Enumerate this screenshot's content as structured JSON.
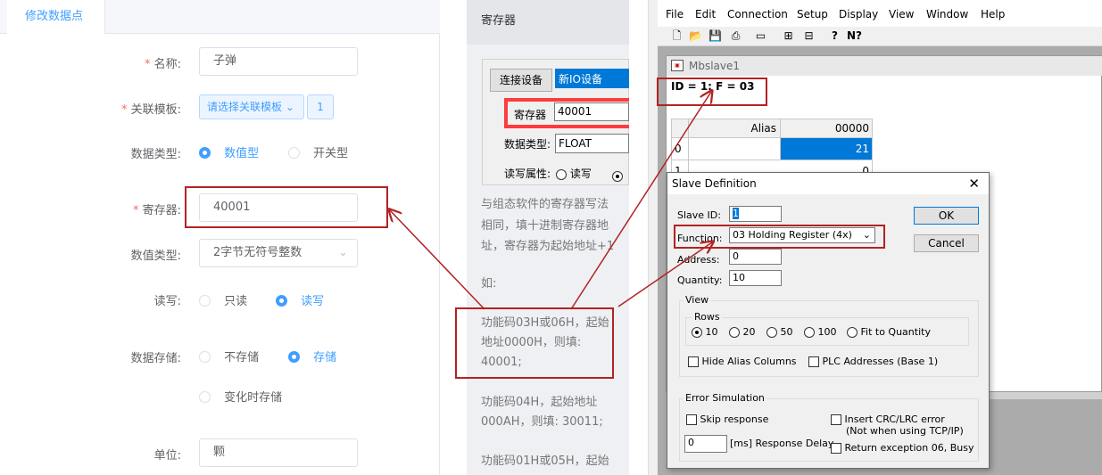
{
  "left_panel": {
    "tab": "修改数据点",
    "name": {
      "label": "名称:",
      "value": "子弹"
    },
    "template": {
      "label": "关联模板:",
      "select": "请选择关联模板",
      "count": "1"
    },
    "data_type": {
      "label": "数据类型:",
      "opt1": "数值型",
      "opt2": "开关型"
    },
    "register": {
      "label": "寄存器:",
      "value": "40001"
    },
    "value_type": {
      "label": "数值类型:",
      "value": "2字节无符号整数"
    },
    "rw": {
      "label": "读写:",
      "opt1": "只读",
      "opt2": "读写"
    },
    "storage": {
      "label": "数据存储:",
      "opt1": "不存储",
      "opt2": "存储",
      "opt3": "变化时存储"
    },
    "unit": {
      "label": "单位:",
      "value": "颗"
    },
    "required_mark": "*"
  },
  "middle_panel": {
    "title": "寄存器",
    "connect_btn": "连接设备",
    "device": "新IO设备",
    "register_label": "寄存器",
    "register_value": "40001",
    "type_label": "数据类型:",
    "type_value": "FLOAT",
    "rw_label": "读写属性:",
    "rw_opt": "读写",
    "desc1": [
      "与组态软件的寄存器写法",
      "相同，填十进制寄存器地",
      "址，寄存器为起始地址+1"
    ],
    "example": "如:",
    "ex1": [
      "功能码03H或06H，起始",
      "地址0000H，则填:",
      "40001;"
    ],
    "ex2": [
      "功能码04H，起始地址",
      "000AH，则填: 30011;"
    ],
    "ex3": "功能码01H或05H，起始"
  },
  "app": {
    "menus": [
      "File",
      "Edit",
      "Connection",
      "Setup",
      "Display",
      "View",
      "Window",
      "Help"
    ],
    "toolbar_icons": [
      "new-icon",
      "open-icon",
      "save-icon",
      "print-icon",
      "window-icon",
      "connect-icon",
      "disconnect-icon",
      "help-icon",
      "context-help-icon"
    ],
    "child_title": "Mbslave1",
    "status": "ID = 1: F = 03",
    "grid": {
      "alias_header": "Alias",
      "col_header": "00000",
      "rows": [
        {
          "idx": "0",
          "val": "21"
        },
        {
          "idx": "1",
          "val": "0"
        }
      ]
    }
  },
  "dialog": {
    "title": "Slave Definition",
    "slave_id_label": "Slave ID:",
    "slave_id": "1",
    "function_label": "Function:",
    "function": "03 Holding Register (4x)",
    "address_label": "Address:",
    "address": "0",
    "quantity_label": "Quantity:",
    "quantity": "10",
    "ok": "OK",
    "cancel": "Cancel",
    "view_label": "View",
    "rows_label": "Rows",
    "rows_opts": [
      "10",
      "20",
      "50",
      "100",
      "Fit to Quantity"
    ],
    "hide_alias": "Hide Alias Columns",
    "plc_addr": "PLC Addresses (Base 1)",
    "error_sim": "Error Simulation",
    "skip": "Skip response",
    "crc": "Insert CRC/LRC error",
    "crc_note": "(Not when using TCP/IP)",
    "delay_value": "0",
    "delay_label": "[ms] Response Delay",
    "exception": "Return exception 06, Busy"
  },
  "colors": {
    "accent": "#409eff",
    "required": "#f56c6c",
    "annotation": "#b22222",
    "selected_cell": "#0078d7"
  }
}
